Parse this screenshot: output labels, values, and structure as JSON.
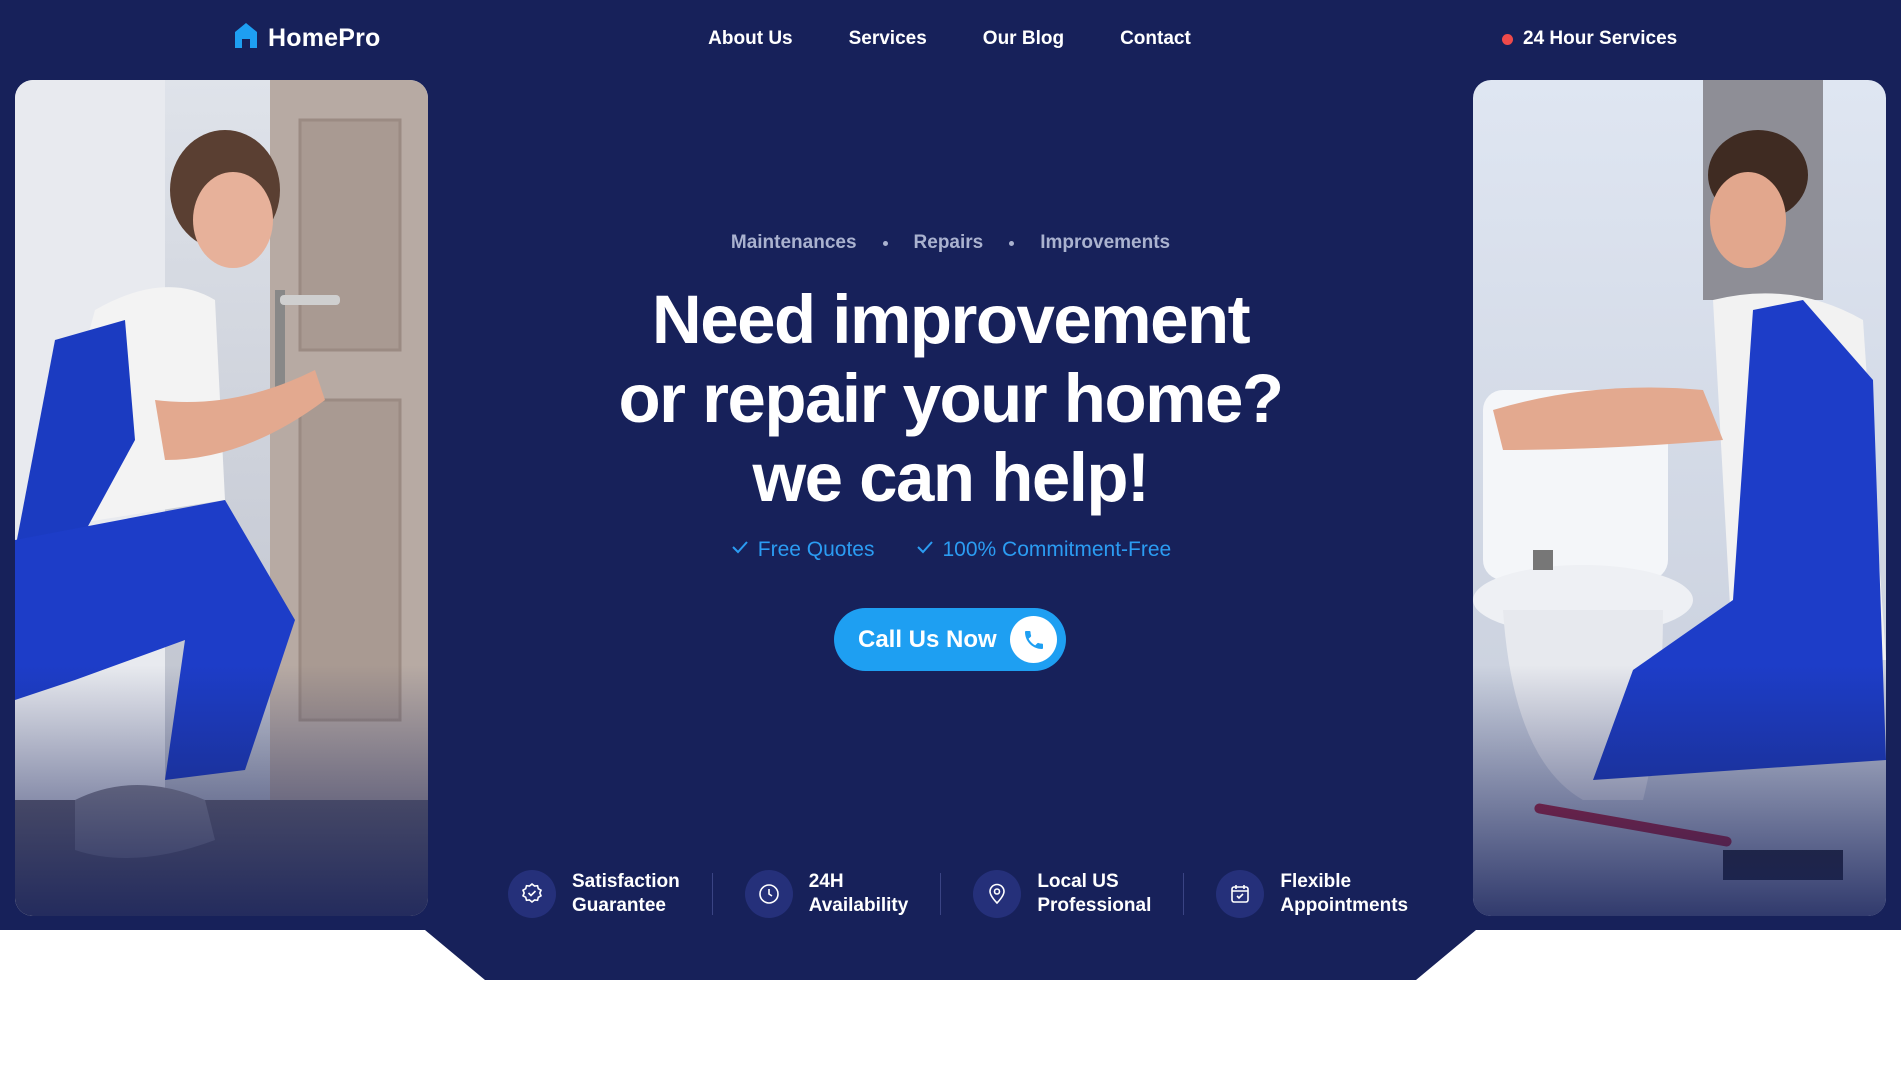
{
  "brand": {
    "name": "HomePro",
    "logo_icon": "house-icon",
    "accent": "#1e9ff2",
    "background": "#17215a"
  },
  "nav": {
    "items": [
      "About Us",
      "Services",
      "Our Blog",
      "Contact"
    ]
  },
  "header": {
    "hours_label": "24 Hour Services",
    "status_dot_color": "#ef4a4a"
  },
  "hero": {
    "tags": [
      "Maintenances",
      "Repairs",
      "Improvements"
    ],
    "headline": [
      "Need improvement",
      "or repair your home?",
      "we can help!"
    ],
    "checks": [
      "Free Quotes",
      "100% Commitment-Free"
    ],
    "cta_label": "Call Us Now",
    "cta_icon": "phone-icon"
  },
  "photos": {
    "left_subject": "technician repairing door lock",
    "right_subject": "plumber fixing toilet"
  },
  "features": [
    {
      "line1": "Satisfaction",
      "line2": "Guarantee",
      "icon": "badge-check-icon"
    },
    {
      "line1": "24H",
      "line2": "Availability",
      "icon": "clock-icon"
    },
    {
      "line1": "Local US",
      "line2": "Professional",
      "icon": "location-pin-icon"
    },
    {
      "line1": "Flexible",
      "line2": "Appointments",
      "icon": "calendar-icon"
    }
  ]
}
